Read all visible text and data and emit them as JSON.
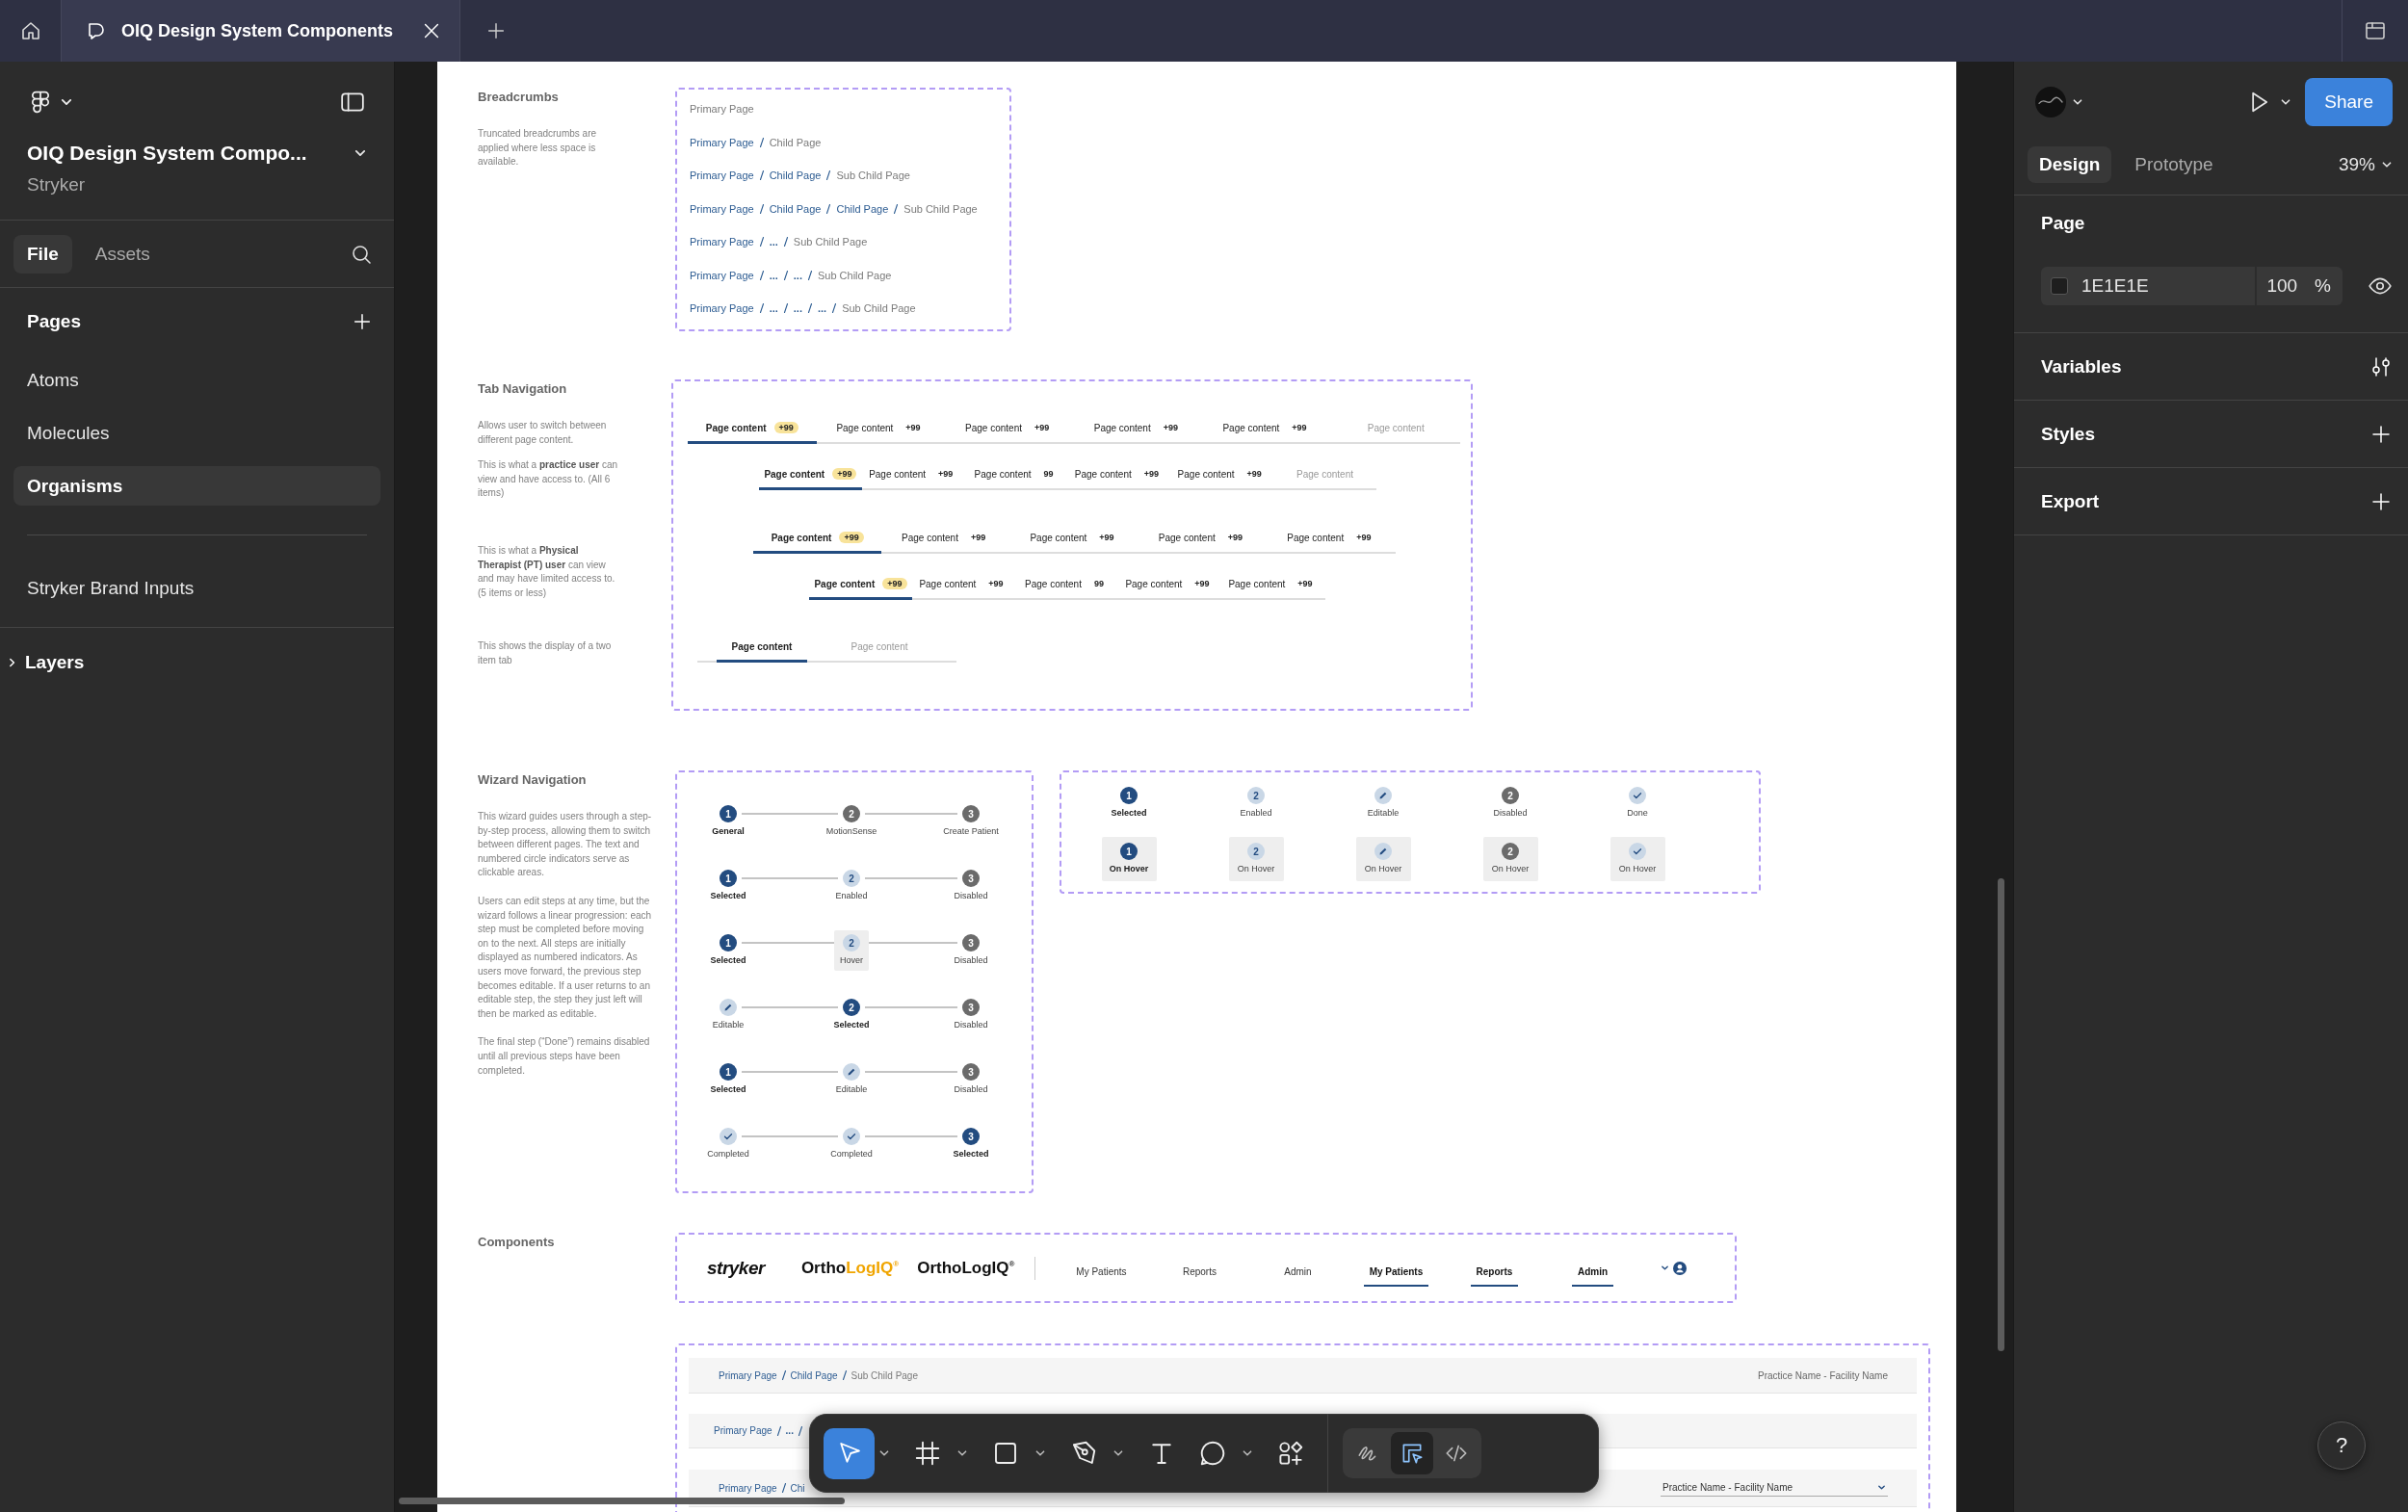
{
  "tab_bar": {
    "tabs": [
      {
        "label": "OIQ Design System Components",
        "selected": true
      }
    ]
  },
  "sidebar": {
    "file_name": "OIQ Design System Compo...",
    "team": "Stryker",
    "tabs": [
      {
        "label": "File",
        "selected": true
      },
      {
        "label": "Assets",
        "selected": false
      }
    ],
    "pages_title": "Pages",
    "page_groups": [
      {
        "pages": [
          {
            "label": "Atoms",
            "selected": false
          },
          {
            "label": "Molecules",
            "selected": false
          },
          {
            "label": "Organisms",
            "selected": true
          }
        ]
      },
      {
        "pages": [
          {
            "label": "Stryker Brand Inputs",
            "selected": false
          }
        ]
      }
    ],
    "layers_title": "Layers"
  },
  "canvas": {
    "breadcrumbs_section": {
      "title": "Breadcrumbs",
      "paragraphs": [
        "Truncated breadcrumbs are applied where less space is available."
      ],
      "rows": [
        {
          "current": "Primary Page"
        },
        {
          "items": [
            "Primary Page"
          ],
          "current": "Child Page"
        },
        {
          "items": [
            "Primary Page",
            "Child Page"
          ],
          "current": "Sub Child Page"
        },
        {
          "items": [
            "Primary Page",
            "Child Page",
            "Child Page"
          ],
          "current": "Sub Child Page"
        },
        {
          "items": [
            "Primary Page",
            "..."
          ],
          "current": "Sub Child Page"
        },
        {
          "items": [
            "Primary Page",
            "...",
            "..."
          ],
          "current": "Sub Child Page"
        },
        {
          "items": [
            "Primary Page",
            "...",
            "...",
            "..."
          ],
          "current": "Sub Child Page"
        }
      ]
    },
    "tab_section": {
      "title": "Tab Navigation",
      "paragraphs": [
        "Allows user to switch between different page content.",
        "This is what a **practice user** can view and have access to. (All 6 items)",
        "This is what a **Physical Therapist (PT) user** can view and may have limited access to. (5 items or less)",
        "This shows the display of a two item tab"
      ],
      "rows": [
        {
          "tabs": [
            {
              "label": "Page content",
              "badge": "+99",
              "selected": true,
              "disabled": false
            },
            {
              "label": "Page content",
              "badge": "+99",
              "selected": false,
              "disabled": false
            },
            {
              "label": "Page content",
              "badge": "+99",
              "selected": false,
              "disabled": false
            },
            {
              "label": "Page content",
              "badge": "+99",
              "selected": false,
              "disabled": false
            },
            {
              "label": "Page content",
              "badge": "+99",
              "selected": false,
              "disabled": false
            },
            {
              "label": "Page content",
              "selected": false,
              "disabled": true
            }
          ]
        },
        {
          "tabs": [
            {
              "label": "Page content",
              "badge": "+99",
              "selected": true,
              "disabled": false
            },
            {
              "label": "Page content",
              "badge": "+99",
              "selected": false,
              "disabled": false
            },
            {
              "label": "Page content",
              "badge": "99",
              "selected": false,
              "disabled": false
            },
            {
              "label": "Page content",
              "badge": "+99",
              "selected": false,
              "disabled": false
            },
            {
              "label": "Page content",
              "badge": "+99",
              "selected": false,
              "disabled": false
            },
            {
              "label": "Page content",
              "selected": false,
              "disabled": true
            }
          ]
        },
        {
          "tabs": [
            {
              "label": "Page content",
              "badge": "+99",
              "selected": true,
              "disabled": false
            },
            {
              "label": "Page content",
              "badge": "+99",
              "selected": false,
              "disabled": false
            },
            {
              "label": "Page content",
              "badge": "+99",
              "selected": false,
              "disabled": false
            },
            {
              "label": "Page content",
              "badge": "+99",
              "selected": false,
              "disabled": false
            },
            {
              "label": "Page content",
              "badge": "+99",
              "selected": false,
              "disabled": false
            }
          ]
        },
        {
          "tabs": [
            {
              "label": "Page content",
              "badge": "+99",
              "selected": true,
              "disabled": false
            },
            {
              "label": "Page content",
              "badge": "+99",
              "selected": false,
              "disabled": false
            },
            {
              "label": "Page content",
              "badge": "99",
              "selected": false,
              "disabled": false
            },
            {
              "label": "Page content",
              "badge": "+99",
              "selected": false,
              "disabled": false
            },
            {
              "label": "Page content",
              "badge": "+99",
              "selected": false,
              "disabled": false
            }
          ]
        },
        {
          "tabs": [
            {
              "label": "Page content",
              "selected": true,
              "disabled": false
            },
            {
              "label": "Page content",
              "selected": false,
              "disabled": true
            }
          ]
        }
      ]
    },
    "wizard_section": {
      "title": "Wizard Navigation",
      "paragraphs": [
        "This wizard guides users through a step-by-step process, allowing them to switch between different pages. The text and numbered circle indicators serve as clickable areas.",
        "Users can edit steps at any time, but the wizard follows a linear progression: each step must be completed before moving on to the next. All steps are initially displayed as numbered indicators. As users move forward, the previous step becomes editable. If a user returns to an editable step, the step they just left will then be marked as editable.",
        "The final step (“Done”) remains disabled until all previous steps have been completed."
      ],
      "rows": [
        {
          "steps": [
            {
              "kind": "selected",
              "number": "1",
              "label": "General",
              "hover": false
            },
            {
              "kind": "disabled",
              "number": "2",
              "label": "MotionSense",
              "hover": false
            },
            {
              "kind": "disabled",
              "number": "3",
              "label": "Create Patient",
              "hover": false
            }
          ]
        },
        {
          "steps": [
            {
              "kind": "selected",
              "number": "1",
              "label": "Selected",
              "hover": false
            },
            {
              "kind": "enabled",
              "number": "2",
              "label": "Enabled",
              "hover": false
            },
            {
              "kind": "disabled",
              "number": "3",
              "label": "Disabled",
              "hover": false
            }
          ]
        },
        {
          "steps": [
            {
              "kind": "selected",
              "number": "1",
              "label": "Selected",
              "hover": false
            },
            {
              "kind": "enabled",
              "number": "2",
              "label": "Hover",
              "hover": true
            },
            {
              "kind": "disabled",
              "number": "3",
              "label": "Disabled",
              "hover": false
            }
          ]
        },
        {
          "steps": [
            {
              "kind": "editable",
              "label": "Editable",
              "hover": false
            },
            {
              "kind": "selected",
              "number": "2",
              "label": "Selected",
              "hover": false
            },
            {
              "kind": "disabled",
              "number": "3",
              "label": "Disabled",
              "hover": false
            }
          ]
        },
        {
          "steps": [
            {
              "kind": "selected",
              "number": "1",
              "label": "Selected",
              "hover": false
            },
            {
              "kind": "editable",
              "label": "Editable",
              "hover": false
            },
            {
              "kind": "disabled",
              "number": "3",
              "label": "Disabled",
              "hover": false
            }
          ]
        },
        {
          "steps": [
            {
              "kind": "completed",
              "label": "Completed",
              "hover": false
            },
            {
              "kind": "completed",
              "label": "Completed",
              "hover": false
            },
            {
              "kind": "selected",
              "number": "3",
              "label": "Selected",
              "hover": false
            }
          ]
        }
      ],
      "states": [
        {
          "steps": [
            {
              "kind": "selected",
              "number": "1",
              "label": "Selected",
              "hover": false
            },
            {
              "kind": "enabled",
              "number": "2",
              "label": "Enabled",
              "hover": false
            },
            {
              "kind": "editable",
              "label": "Editable",
              "hover": false
            },
            {
              "kind": "disabled",
              "number": "2",
              "label": "Disabled",
              "hover": false
            },
            {
              "kind": "completed",
              "label": "Done",
              "hover": false
            }
          ]
        },
        {
          "steps": [
            {
              "kind": "selected",
              "number": "1",
              "label": "On Hover",
              "hover": true
            },
            {
              "kind": "enabled",
              "number": "2",
              "label": "On Hover",
              "hover": true
            },
            {
              "kind": "editable",
              "label": "On Hover",
              "hover": true
            },
            {
              "kind": "disabled",
              "number": "2",
              "label": "On Hover",
              "hover": true
            },
            {
              "kind": "completed",
              "label": "On Hover",
              "hover": true
            }
          ]
        }
      ]
    },
    "components_section": {
      "title": "Components",
      "logos": [
        {
          "kind": "stryker",
          "text": "stryker"
        },
        {
          "kind": "two-tone",
          "text": "Ortho",
          "accent": "LogIQ$^{®}$"
        },
        {
          "kind": "mono",
          "text": "OrthoLogIQ$^{®}$"
        }
      ],
      "nav": [
        {
          "label": "My Patients",
          "selected": false
        },
        {
          "label": "Reports",
          "selected": false
        },
        {
          "label": "Admin",
          "selected": false
        },
        {
          "label": "My Patients",
          "selected": true
        },
        {
          "label": "Reports",
          "selected": true
        },
        {
          "label": "Admin",
          "selected": true
        }
      ]
    },
    "page_headers": [
      {
        "items": [
          "Primary Page",
          "Child Page"
        ],
        "current": "Sub Child Page",
        "facility": "Practice Name - Facility Name",
        "kind": "text"
      },
      {
        "items": [
          "Primary Page",
          "..."
        ],
        "trailing_slash": true
      },
      {
        "items": [
          "Primary Page",
          "Chi"
        ],
        "facility": "Practice Name - Facility Name",
        "kind": "dropdown"
      }
    ]
  },
  "toolbar": {
    "tools": [
      {
        "kind": "move",
        "selected": true,
        "caret": true
      },
      {
        "kind": "frame",
        "selected": false,
        "caret": true
      },
      {
        "kind": "shape",
        "selected": false,
        "caret": true
      },
      {
        "kind": "pen",
        "selected": false,
        "caret": true
      },
      {
        "kind": "text",
        "selected": false,
        "caret": false
      },
      {
        "kind": "comment",
        "selected": false,
        "caret": true
      },
      {
        "kind": "actions",
        "selected": false,
        "caret": false
      }
    ],
    "modes": [
      {
        "kind": "draw",
        "selected": false
      },
      {
        "kind": "design",
        "selected": true
      },
      {
        "kind": "dev",
        "selected": false
      }
    ]
  },
  "right_panel": {
    "share": "Share",
    "tabs": [
      {
        "label": "Design",
        "selected": true
      },
      {
        "label": "Prototype",
        "selected": false
      }
    ],
    "zoom": "39%",
    "page_title": "Page",
    "color": "1E1E1E",
    "opacity": "100",
    "percent": "%",
    "sections": [
      {
        "label": "Variables",
        "kind": "variables"
      },
      {
        "label": "Styles",
        "kind": "add"
      },
      {
        "label": "Export",
        "kind": "add"
      }
    ],
    "help": "?"
  }
}
